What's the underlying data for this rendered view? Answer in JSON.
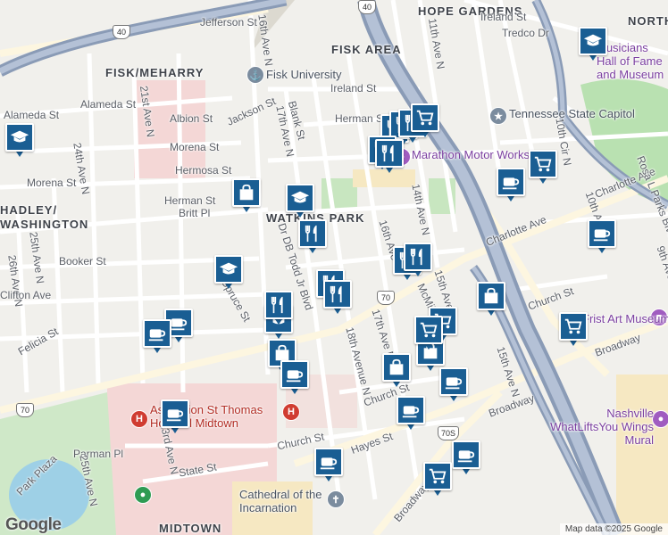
{
  "map": {
    "attribution": "Map data ©2025 Google",
    "logo": "Google",
    "neighborhoods": [
      "HOPE GARDENS",
      "NORTH",
      "FISK AREA",
      "FISK/MEHARRY",
      "HADLEY/",
      "WASHINGTON",
      "WATKINS PARK",
      "MIDTOWN"
    ],
    "streets": [
      "Jefferson St",
      "11th Ave N",
      "Ireland St",
      "Tredco Dr",
      "Ireland St",
      "Herman St",
      "16th Ave N",
      "17th Ave N",
      "Blank St",
      "Jackson St",
      "21st Ave N",
      "Alameda St",
      "Alameda St",
      "Albion St",
      "Morena St",
      "Hermosa St",
      "24th Ave N",
      "Morena St",
      "Herman St",
      "Britt Pl",
      "Booker St",
      "25th Ave N",
      "26th Ave N",
      "Felicia St",
      "Clifton Ave",
      "Spruce St",
      "Dr DB Todd Jr Blvd",
      "18th Avenue N",
      "17th Ave N",
      "16th Ave N",
      "15th Ave N",
      "14th Ave N",
      "Charlotte Ave",
      "Charlotte Ave",
      "10th Cir N",
      "Rosa L Parks Blvd",
      "10th Ave N",
      "9th Ave",
      "Church St",
      "Church St",
      "Church St",
      "Broadway",
      "Broadway",
      "Broadway",
      "15th Ave N",
      "Hayes St",
      "State St",
      "23rd Ave N",
      "Parman Pl",
      "Park Plaza",
      "25th Ave N",
      "McMillin St"
    ],
    "pois": [
      {
        "name": "Fisk University",
        "icon": "university-icon"
      },
      {
        "name": "Marathon Motor Works",
        "icon": "building-icon"
      },
      {
        "name": "Tennessee State Capitol",
        "icon": "landmark-icon"
      },
      {
        "name": "Musicians Hall of Fame and Museum",
        "icon": "museum-icon"
      },
      {
        "name": "Frist Art Museum",
        "icon": "museum-icon"
      },
      {
        "name": "Ascension St Thomas Hospital Midtown",
        "icon": "hospital-icon"
      },
      {
        "name": "Cathedral of the Incarnation",
        "icon": "church-icon"
      },
      {
        "name": "Nashville WhatLiftsYou Wings Mural",
        "icon": "mural-icon"
      }
    ],
    "highway_shields": [
      "40",
      "70",
      "70",
      "70S"
    ],
    "marker_types": {
      "school": "graduation-cap-icon",
      "restaurant": "fork-knife-icon",
      "store": "shopping-bag-icon",
      "cafe": "coffee-cup-icon",
      "grocery": "shopping-cart-icon"
    }
  }
}
